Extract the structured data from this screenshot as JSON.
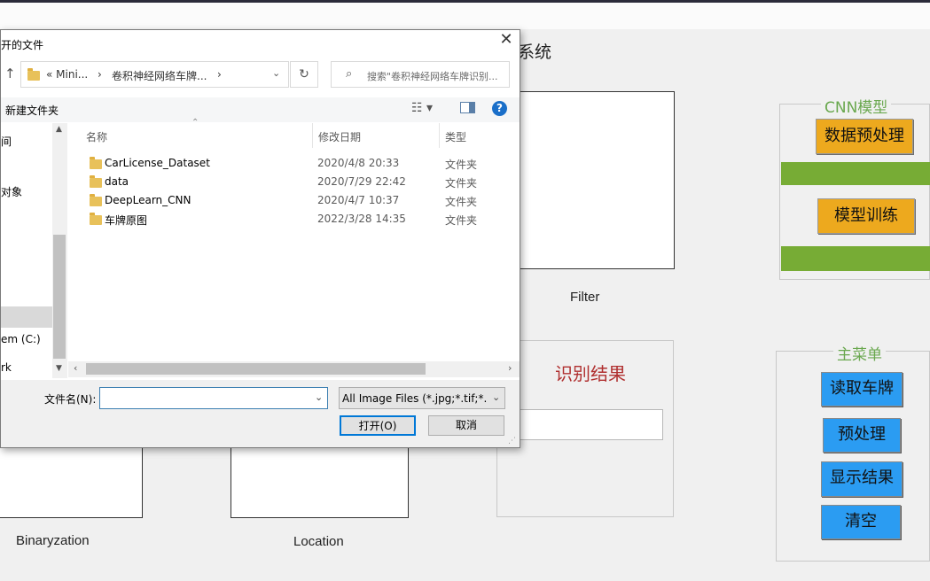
{
  "app": {
    "title_fragment": "系统",
    "panels": {
      "filter_label": "Filter",
      "binary_label": "Binaryzation",
      "location_label": "Location"
    },
    "result": {
      "title": "识别结果",
      "value": ""
    },
    "cnn_group": {
      "title": "CNN模型",
      "preprocess_button": "数据预处理",
      "train_button": "模型训练"
    },
    "menu_group": {
      "title": "主菜单",
      "read_button": "读取车牌",
      "preprocess_button": "预处理",
      "show_button": "显示结果",
      "clear_button": "清空"
    },
    "colors": {
      "orange": "#eda91e",
      "blue": "#2b9cf2",
      "green": "#77ac35",
      "result_title": "#b03030",
      "group_title": "#6aa84f"
    }
  },
  "dialog": {
    "title": "开的文件",
    "close_icon": "close-icon",
    "address": {
      "part1": "«  Mini...",
      "part2": "卷积神经网络车牌...",
      "sep": "›"
    },
    "search_placeholder": "搜索\"卷积神经网络车牌识别...",
    "new_folder": "新建文件夹",
    "help": "?",
    "nav_items": [
      "间",
      "对象",
      "em (C:)",
      "rk"
    ],
    "columns": {
      "name": "名称",
      "date": "修改日期",
      "type": "类型"
    },
    "files": [
      {
        "name": "CarLicense_Dataset",
        "date": "2020/4/8 20:33",
        "type": "文件夹"
      },
      {
        "name": "data",
        "date": "2020/7/29 22:42",
        "type": "文件夹"
      },
      {
        "name": "DeepLearn_CNN",
        "date": "2020/4/7 10:37",
        "type": "文件夹"
      },
      {
        "name": "车牌原图",
        "date": "2022/3/28 14:35",
        "type": "文件夹"
      }
    ],
    "filename_label": "文件名(N):",
    "filename_value": "",
    "filter_value": "All Image Files (*.jpg;*.tif;*.pr",
    "open_button": "打开(O)",
    "cancel_button": "取消"
  }
}
